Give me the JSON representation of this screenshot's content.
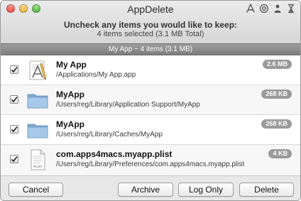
{
  "window": {
    "title": "AppDelete"
  },
  "header": {
    "instruction": "Uncheck any items you would like to keep:",
    "selected_count": "4 items selected (3.1 MB Total)"
  },
  "group": {
    "label": "My App ~ 4 items (3.1 MB)"
  },
  "title_icons": [
    "app-store-icon",
    "target-icon",
    "person-icon",
    "hourglass-icon"
  ],
  "items": [
    {
      "name": "My App",
      "path": "/Applications/My App.app",
      "size": "2.6 MB",
      "checked": true,
      "icon": "app-bundle-icon"
    },
    {
      "name": "MyApp",
      "path": "/Users/reg/Library/Application Support/MyApp",
      "size": "268 KB",
      "checked": true,
      "icon": "folder-icon"
    },
    {
      "name": "MyApp",
      "path": "/Users/reg/Library/Caches/MyApp",
      "size": "268 KB",
      "checked": true,
      "icon": "folder-icon"
    },
    {
      "name": "com.apps4macs.myapp.plist",
      "path": "/Users/reg/Library/Preferences/com.apps4macs.myapp.plist",
      "size": "4 KB",
      "checked": true,
      "icon": "plist-file-icon",
      "icon_label": "PLIST"
    }
  ],
  "buttons": {
    "cancel": "Cancel",
    "archive": "Archive",
    "log_only": "Log Only",
    "delete": "Delete"
  },
  "colors": {
    "group_bar": "#8c8c8c",
    "badge": "#9a9a9a",
    "folder": "#8fb6dc"
  }
}
